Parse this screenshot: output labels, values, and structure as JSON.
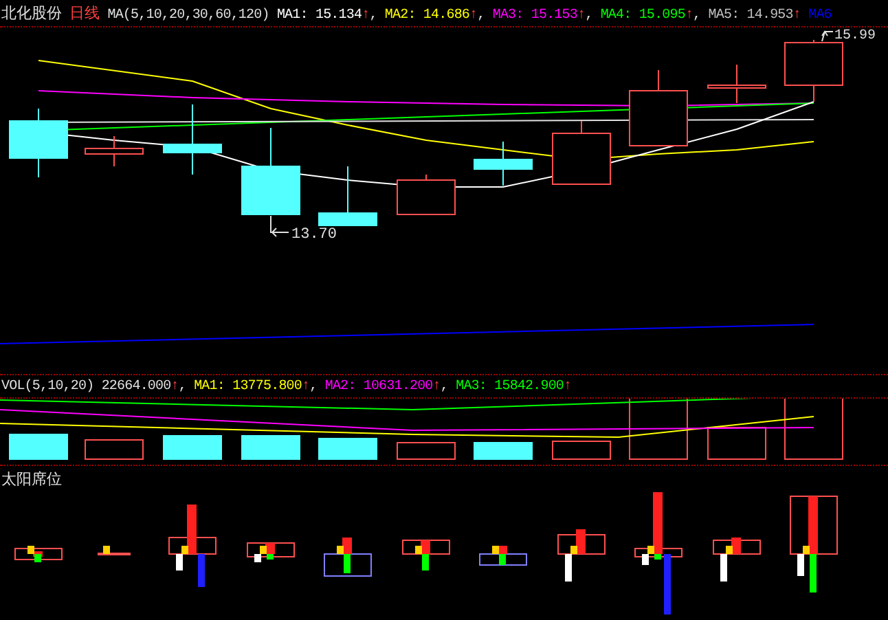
{
  "header": {
    "title": "北化股份",
    "period": "日线",
    "indicator": "MA(5,10,20,30,60,120)",
    "items": [
      {
        "label": "MA1:",
        "value": "15.134",
        "arrow": "↑",
        "suffix": ",",
        "color": "#ffffff"
      },
      {
        "label": "MA2:",
        "value": "14.686",
        "arrow": "↑",
        "suffix": ",",
        "color": "#ffff00"
      },
      {
        "label": "MA3:",
        "value": "15.153",
        "arrow": "↑",
        "suffix": ",",
        "color": "#ff00ff"
      },
      {
        "label": "MA4:",
        "value": "15.095",
        "arrow": "↑",
        "suffix": ",",
        "color": "#00ff00"
      },
      {
        "label": "MA5:",
        "value": "14.953",
        "arrow": "↑",
        "color": "#c0c0c0"
      },
      {
        "label": "MA6",
        "color": "#0000ff"
      }
    ]
  },
  "price_labels": {
    "high": "15.99",
    "low": "13.70"
  },
  "volume_header": {
    "indicator": "VOL(5,10,20)",
    "value": "22664.000",
    "arrow": "↑",
    "suffix": ",",
    "items": [
      {
        "label": "MA1:",
        "value": "13775.800",
        "arrow": "↑",
        "suffix": ",",
        "color": "#ffff00"
      },
      {
        "label": "MA2:",
        "value": "10631.200",
        "arrow": "↑",
        "suffix": ",",
        "color": "#ff00ff"
      },
      {
        "label": "MA3:",
        "value": "15842.900",
        "arrow": "↑",
        "color": "#00ff00"
      }
    ]
  },
  "bottom_panel": {
    "title": "太阳席位"
  }
}
